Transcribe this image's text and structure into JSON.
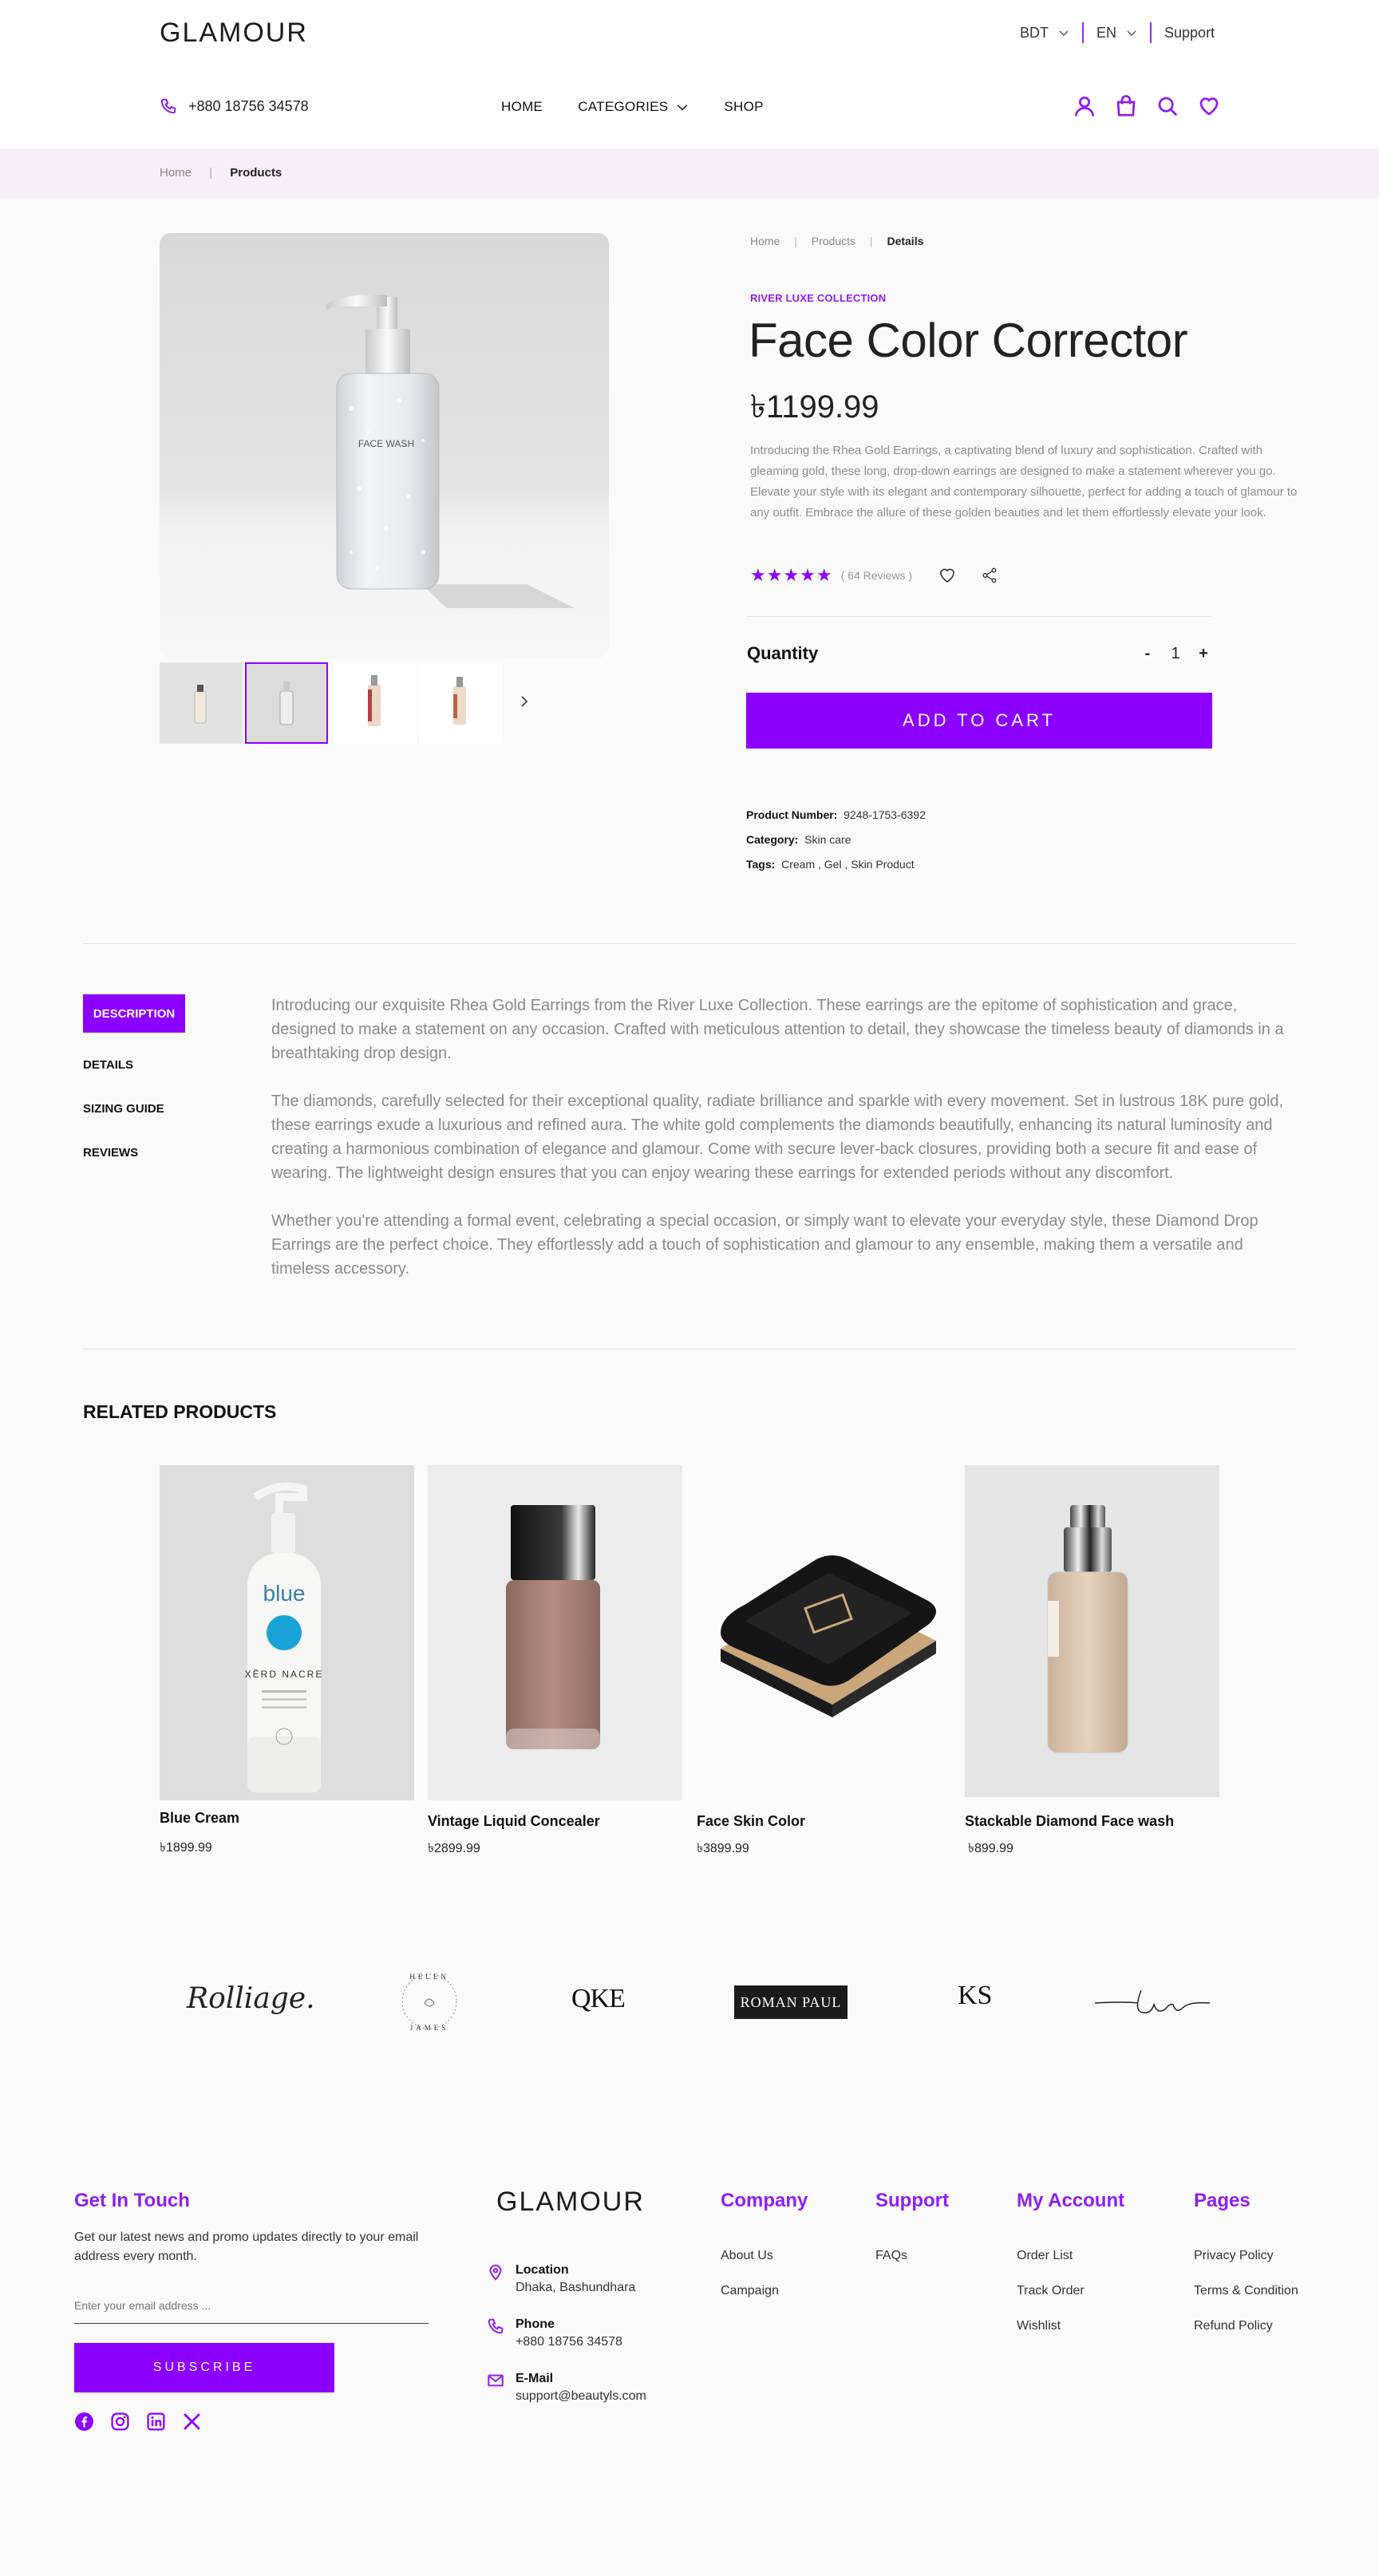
{
  "header": {
    "logo": "GLAMOUR",
    "currency": "BDT",
    "language": "EN",
    "support": "Support",
    "phone": "+880 18756 34578",
    "nav": [
      "HOME",
      "CATEGORIES",
      "SHOP"
    ]
  },
  "page_breadcrumb": {
    "home": "Home",
    "current": "Products"
  },
  "product": {
    "breadcrumb": [
      "Home",
      "Products",
      "Details"
    ],
    "collection": "RIVER LUXE COLLECTION",
    "title": "Face Color Corrector",
    "price": "৳1199.99",
    "intro": "Introducing the Rhea Gold Earrings, a captivating blend of luxury and sophistication. Crafted with gleaming gold, these long, drop-down earrings are designed to make a statement wherever you go. Elevate your style with its elegant and contemporary silhouette, perfect for adding a touch of glamour to any outfit. Embrace the allure of these golden beauties and let them effortlessly elevate your look.",
    "rating": 5,
    "reviews": "( 64 Reviews )",
    "quantity_label": "Quantity",
    "quantity": "1",
    "minus": "-",
    "plus": "+",
    "add_to_cart": "ADD TO CART",
    "image_label": "FACE WASH",
    "meta": {
      "number_label": "Product Number:",
      "number": "9248-1753-6392",
      "category_label": "Category:",
      "category": "Skin care",
      "tags_label": "Tags:",
      "tags": "Cream , Gel , Skin Product"
    }
  },
  "tabs": [
    "DESCRIPTION",
    "DETAILS",
    "SIZING GUIDE",
    "REVIEWS"
  ],
  "description": [
    "Introducing our exquisite Rhea Gold Earrings from the River Luxe Collection. These earrings are the epitome of sophistication and grace, designed to make a statement on any occasion. Crafted with meticulous attention to detail, they showcase the timeless beauty of diamonds in a breathtaking drop design.",
    "The diamonds, carefully selected for their exceptional quality, radiate brilliance and sparkle with every movement. Set in lustrous 18K pure gold, these earrings exude a luxurious and refined aura. The white gold complements the diamonds beautifully, enhancing its natural luminosity and creating a harmonious combination of elegance and glamour. Come with secure lever-back closures, providing both a secure fit and ease of wearing. The lightweight design ensures that you can enjoy wearing these earrings for extended periods without any discomfort.",
    "Whether you're attending a formal event, celebrating a special occasion, or simply want to elevate your everyday style, these Diamond Drop Earrings are the perfect choice. They effortlessly add a touch of sophistication and glamour to any ensemble, making them a versatile and timeless accessory."
  ],
  "related": {
    "heading": "RELATED PRODUCTS",
    "items": [
      {
        "name": "Blue Cream",
        "price": "৳1899.99",
        "brand": "blue",
        "label": "XËRD NACRE"
      },
      {
        "name": "Vintage Liquid Concealer",
        "price": "৳2899.99"
      },
      {
        "name": "Face Skin Color",
        "price": "৳3899.99"
      },
      {
        "name": "Stackable Diamond Face wash",
        "price": "৳899.99"
      }
    ]
  },
  "brands": [
    "Rolliage.",
    "HELEN JAMES",
    "QKE",
    "ROMAN PAUL",
    "KS",
    "Lou"
  ],
  "footer": {
    "get_in_touch": "Get In Touch",
    "newsletter_text": "Get our latest news and promo updates directly to your email address every month.",
    "email_placeholder": "Enter your email address ...",
    "subscribe": "SUBSCRIBE",
    "logo": "GLAMOUR",
    "location_label": "Location",
    "location": "Dhaka, Bashundhara",
    "phone_label": "Phone",
    "phone": "+880 18756 34578",
    "email_label": "E-Mail",
    "email": "support@beautyls.com",
    "columns": [
      {
        "title": "Company",
        "links": [
          "About Us",
          "Campaign"
        ]
      },
      {
        "title": "Support",
        "links": [
          "FAQs"
        ]
      },
      {
        "title": "My Account",
        "links": [
          "Order List",
          "Track Order",
          "Wishlist"
        ]
      },
      {
        "title": "Pages",
        "links": [
          "Privacy Policy",
          "Terms & Condition",
          "Refund Policy"
        ]
      }
    ]
  },
  "colors": {
    "accent": "#8c00ff",
    "crumb_bg": "#f7eff8"
  }
}
